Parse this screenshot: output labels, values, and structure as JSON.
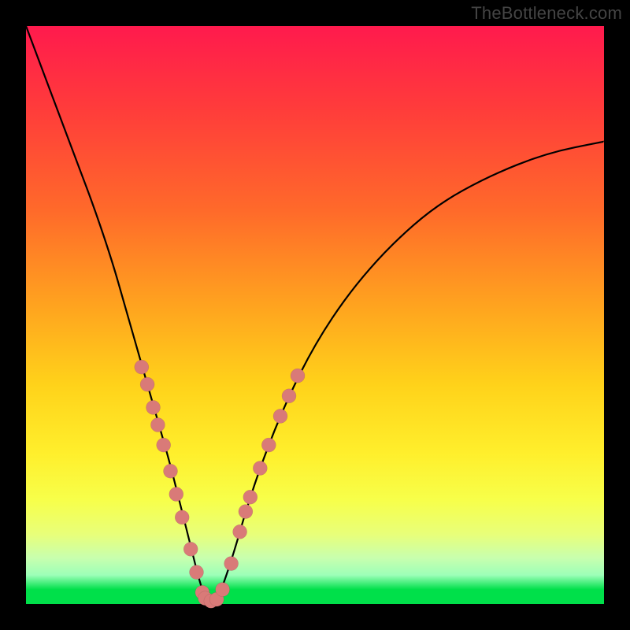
{
  "watermark": "TheBottleneck.com",
  "colors": {
    "frame": "#000000",
    "marker": "#d97a78",
    "curve": "#000000"
  },
  "chart_data": {
    "type": "line",
    "title": "",
    "xlabel": "",
    "ylabel": "",
    "xlim": [
      0,
      100
    ],
    "ylim": [
      0,
      100
    ],
    "series": [
      {
        "name": "bottleneck-curve",
        "x": [
          0,
          3,
          6,
          9,
          12,
          15,
          17,
          19,
          21,
          23,
          25,
          27,
          28.5,
          30,
          31,
          32,
          33,
          34,
          36,
          38,
          41,
          45,
          50,
          56,
          63,
          71,
          80,
          90,
          100
        ],
        "y": [
          100,
          92,
          84,
          76,
          68,
          59,
          52,
          45,
          38,
          31,
          24,
          16,
          10,
          4,
          1,
          0,
          0.8,
          3,
          9,
          16,
          25,
          35,
          45,
          54,
          62,
          69,
          74,
          78,
          80
        ]
      }
    ],
    "markers": {
      "name": "highlighted-points",
      "points": [
        {
          "x": 20.0,
          "y": 41.0
        },
        {
          "x": 21.0,
          "y": 38.0
        },
        {
          "x": 22.0,
          "y": 34.0
        },
        {
          "x": 22.8,
          "y": 31.0
        },
        {
          "x": 23.8,
          "y": 27.5
        },
        {
          "x": 25.0,
          "y": 23.0
        },
        {
          "x": 26.0,
          "y": 19.0
        },
        {
          "x": 27.0,
          "y": 15.0
        },
        {
          "x": 28.5,
          "y": 9.5
        },
        {
          "x": 29.5,
          "y": 5.5
        },
        {
          "x": 30.5,
          "y": 2.0
        },
        {
          "x": 31.0,
          "y": 1.0
        },
        {
          "x": 32.0,
          "y": 0.5
        },
        {
          "x": 33.0,
          "y": 0.8
        },
        {
          "x": 34.0,
          "y": 2.5
        },
        {
          "x": 35.5,
          "y": 7.0
        },
        {
          "x": 37.0,
          "y": 12.5
        },
        {
          "x": 38.0,
          "y": 16.0
        },
        {
          "x": 38.8,
          "y": 18.5
        },
        {
          "x": 40.5,
          "y": 23.5
        },
        {
          "x": 42.0,
          "y": 27.5
        },
        {
          "x": 44.0,
          "y": 32.5
        },
        {
          "x": 45.5,
          "y": 36.0
        },
        {
          "x": 47.0,
          "y": 39.5
        }
      ]
    }
  }
}
